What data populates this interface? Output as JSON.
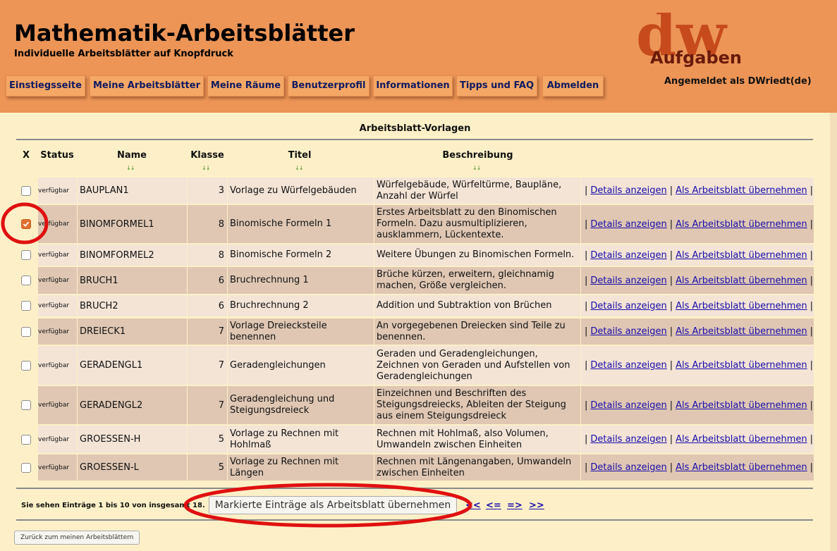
{
  "header": {
    "title": "Mathematik-Arbeitsblätter",
    "subtitle": "Individuelle Arbeitsblätter auf Knopfdruck",
    "logo_big": "dw",
    "logo_small": "Aufgaben",
    "logged_in": "Angemeldet als DWriedt(de)"
  },
  "nav": [
    {
      "label": "Einstiegsseite"
    },
    {
      "label": "Meine Arbeitsblätter"
    },
    {
      "label": "Meine Räume"
    },
    {
      "label": "Benutzerprofil"
    },
    {
      "label": "Informationen"
    },
    {
      "label": "Tipps und FAQ"
    },
    {
      "label": "Abmelden"
    }
  ],
  "table": {
    "title": "Arbeitsblatt-Vorlagen",
    "headers": {
      "x": "X",
      "status": "Status",
      "name": "Name",
      "klasse": "Klasse",
      "titel": "Titel",
      "beschreibung": "Beschreibung"
    },
    "sort_icon": "↓↓",
    "action_details": "Details anzeigen",
    "action_adopt": "Als Arbeitsblatt übernehmen",
    "pipe": "|",
    "rows": [
      {
        "checked": false,
        "status": "verfügbar",
        "name": "BAUPLAN1",
        "klasse": "3",
        "titel": "Vorlage zu Würfelgebäuden",
        "beschreibung": "Würfelgebäude, Würfeltürme, Baupläne, Anzahl der Würfel"
      },
      {
        "checked": true,
        "status": "verfügbar",
        "name": "BINOMFORMEL1",
        "klasse": "8",
        "titel": "Binomische Formeln 1",
        "beschreibung": "Erstes Arbeitsblatt zu den Binomischen Formeln. Dazu ausmultiplizieren, ausklammern, Lückentexte."
      },
      {
        "checked": false,
        "status": "verfügbar",
        "name": "BINOMFORMEL2",
        "klasse": "8",
        "titel": "Binomische Formeln 2",
        "beschreibung": "Weitere Übungen zu Binomischen Formeln."
      },
      {
        "checked": false,
        "status": "verfügbar",
        "name": "BRUCH1",
        "klasse": "6",
        "titel": "Bruchrechnung 1",
        "beschreibung": "Brüche kürzen, erweitern, gleichnamig machen, Größe vergleichen."
      },
      {
        "checked": false,
        "status": "verfügbar",
        "name": "BRUCH2",
        "klasse": "6",
        "titel": "Bruchrechnung 2",
        "beschreibung": "Addition und Subtraktion von Brüchen"
      },
      {
        "checked": false,
        "status": "verfügbar",
        "name": "DREIECK1",
        "klasse": "7",
        "titel": "Vorlage Dreiecksteile benennen",
        "beschreibung": "An vorgegebenen Dreiecken sind Teile zu benennen."
      },
      {
        "checked": false,
        "status": "verfügbar",
        "name": "GERADENGL1",
        "klasse": "7",
        "titel": "Geradengleichungen",
        "beschreibung": "Geraden und Geradengleichungen, Zeichnen von Geraden und Aufstellen von Geradengleichungen"
      },
      {
        "checked": false,
        "status": "verfügbar",
        "name": "GERADENGL2",
        "klasse": "7",
        "titel": "Geradengleichung und Steigungsdreieck",
        "beschreibung": "Einzeichnen und Beschriften des Steigungsdreiecks, Ableiten der Steigung aus einem Steigungsdreieck"
      },
      {
        "checked": false,
        "status": "verfügbar",
        "name": "GROESSEN-H",
        "klasse": "5",
        "titel": "Vorlage zu Rechnen mit Hohlmaß",
        "beschreibung": "Rechnen mit Hohlmaß, also Volumen, Umwandeln zwischen Einheiten"
      },
      {
        "checked": false,
        "status": "verfügbar",
        "name": "GROESSEN-L",
        "klasse": "5",
        "titel": "Vorlage zu Rechnen mit Längen",
        "beschreibung": "Rechnen mit Längenangaben, Umwandeln zwischen Einheiten"
      }
    ]
  },
  "footer": {
    "info": "Sie sehen Einträge 1 bis 10 von insgesamt 18.",
    "mark_button": "Markierte Einträge als Arbeitsblatt übernehmen",
    "pager": [
      "<<",
      "<=",
      "=>",
      ">>"
    ],
    "back_button": "Zurück zum meinen Arbeitsblättern"
  },
  "colors": {
    "header_bg": "#ec9557",
    "page_bg": "#fdf0c8",
    "row_light": "#f3e4d6",
    "row_dark": "#dfc7b3",
    "nav_text": "#0f1a62",
    "annotation": "#e01010"
  }
}
